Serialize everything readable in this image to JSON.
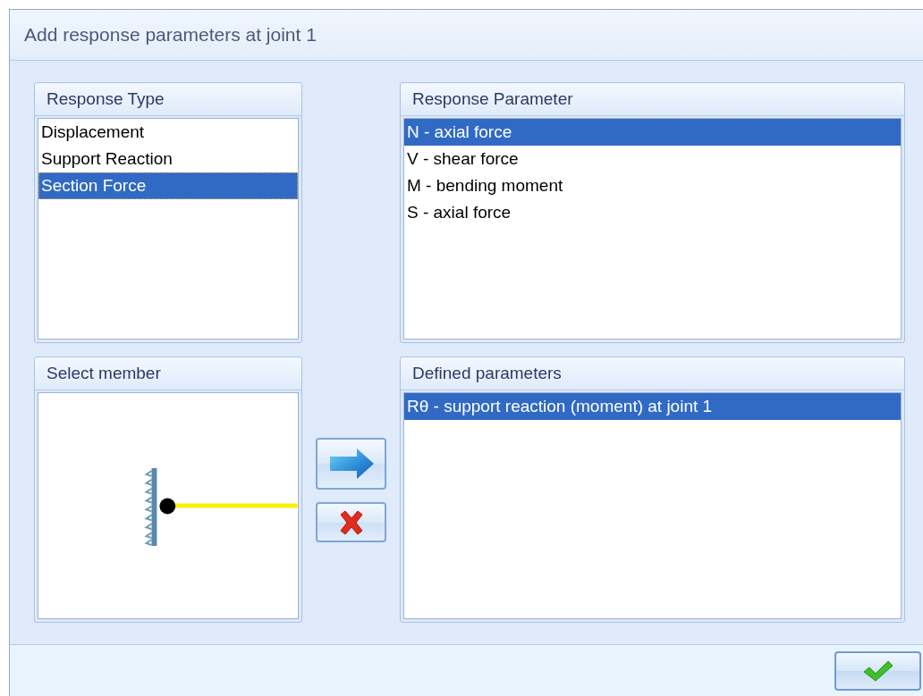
{
  "window": {
    "title": "Add response parameters at joint 1"
  },
  "response_type": {
    "title": "Response Type",
    "focused": true,
    "items": [
      {
        "label": "Displacement",
        "selected": false
      },
      {
        "label": "Support Reaction",
        "selected": false
      },
      {
        "label": "Section Force",
        "selected": true
      }
    ]
  },
  "response_parameter": {
    "title": "Response Parameter",
    "focused": false,
    "items": [
      {
        "label": "N - axial force",
        "selected": true
      },
      {
        "label": "V - shear force",
        "selected": false
      },
      {
        "label": "M - bending moment",
        "selected": false
      },
      {
        "label": "S - axial force",
        "selected": false
      }
    ]
  },
  "select_member": {
    "title": "Select member"
  },
  "defined_parameters": {
    "title": "Defined parameters",
    "focused": false,
    "items": [
      {
        "label": "Rθ - support reaction (moment) at joint 1",
        "selected": true
      }
    ]
  }
}
